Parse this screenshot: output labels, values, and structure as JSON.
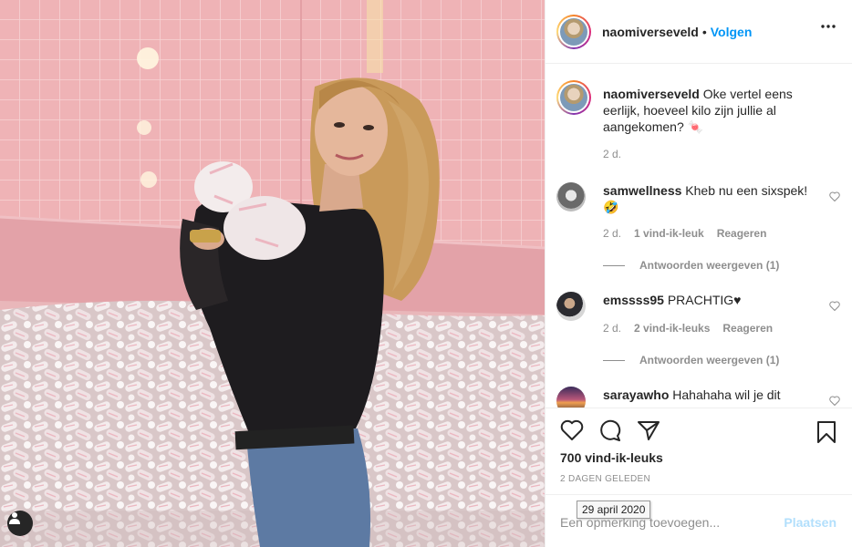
{
  "post": {
    "username": "naomiverseveld",
    "follow_label": "Volgen",
    "separator": "•"
  },
  "caption": {
    "username": "naomiverseveld",
    "text": "Oke vertel eens eerlijk, hoeveel kilo zijn jullie al aangekomen? 🍬",
    "time": "2 d."
  },
  "comments": [
    {
      "username": "samwellness",
      "text": "Kheb nu een sixspek! 🤣",
      "time": "2 d.",
      "likes": "1 vind-ik-leuk",
      "reply_label": "Reageren",
      "view_replies": "Antwoorden weergeven (1)"
    },
    {
      "username": "emssss95",
      "text": "PRACHTIG♥",
      "time": "2 d.",
      "likes": "2 vind-ik-leuks",
      "reply_label": "Reageren",
      "view_replies": "Antwoorden weergeven (1)"
    },
    {
      "username": "sarayawho",
      "text": "Hahahaha wil je dit"
    }
  ],
  "actions": {
    "like_count": "700 vind-ik-leuks",
    "posted_ago": "2 DAGEN GELEDEN",
    "tooltip_date": "29 april 2020"
  },
  "add_comment": {
    "placeholder": "Een opmerking toevoegen...",
    "post_label": "Plaatsen"
  },
  "icons": [
    "user-tag-icon",
    "more-icon",
    "heart-icon",
    "comment-icon",
    "share-icon",
    "bookmark-icon"
  ],
  "colors": {
    "accent": "#0095f6",
    "post_disabled": "#b2dffc",
    "muted": "#8e8e8e",
    "text": "#262626"
  }
}
